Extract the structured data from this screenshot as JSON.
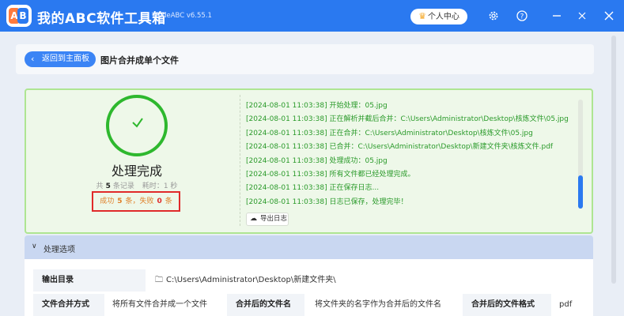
{
  "app": {
    "title": "我的ABC软件工具箱",
    "version": "WodeABC v6.55.1",
    "logo_left": "A",
    "logo_right": "B",
    "vip_label": "个人中心",
    "colors": {
      "titlebar": "#2a79f0",
      "success": "#2eb82e",
      "error": "#e02a2a"
    }
  },
  "toolbar": {
    "icons": [
      "crown-icon",
      "settings-icon",
      "help-icon",
      "minimize-icon",
      "close-icon"
    ]
  },
  "header": {
    "back_label": "返回到主面板",
    "page_title": "图片合并成单个文件"
  },
  "result": {
    "status_title": "处理完成",
    "total_prefix": "共",
    "total_count": "5",
    "total_suffix": "条记录",
    "time_label": "耗时：1 秒",
    "success_label": "成功",
    "success_count": "5",
    "success_unit": "条，失败",
    "fail_count": "0",
    "fail_unit": "条"
  },
  "log": {
    "lines": [
      "[2024-08-01 11:03:38] 开始处理：05.jpg",
      "[2024-08-01 11:03:38] 正在解析并截后合并：C:\\Users\\Administrator\\Desktop\\核炼文件\\05.jpg",
      "[2024-08-01 11:03:38] 正在合并：C:\\Users\\Administrator\\Desktop\\核炼文件\\05.jpg",
      "[2024-08-01 11:03:38] 已合并：C:\\Users\\Administrator\\Desktop\\新建文件夹\\核炼文件.pdf",
      "[2024-08-01 11:03:38] 处理成功：05.jpg",
      "[2024-08-01 11:03:38] 所有文件都已经处理完成。",
      "[2024-08-01 11:03:38] 正在保存日志...",
      "[2024-08-01 11:03:38] 日志已保存，处理完毕！"
    ],
    "export_label": "导出日志"
  },
  "options": {
    "header_label": "处理选项",
    "output_dir_label": "输出目录",
    "output_dir_value": "C:\\Users\\Administrator\\Desktop\\新建文件夹\\",
    "merge_mode_label": "文件合并方式",
    "merge_mode_value": "将所有文件合并成一个文件",
    "merged_name_label": "合并后的文件名",
    "merged_name_value": "将文件夹的名字作为合并后的文件名",
    "merged_format_label": "合并后的文件格式",
    "merged_format_value": "pdf"
  }
}
